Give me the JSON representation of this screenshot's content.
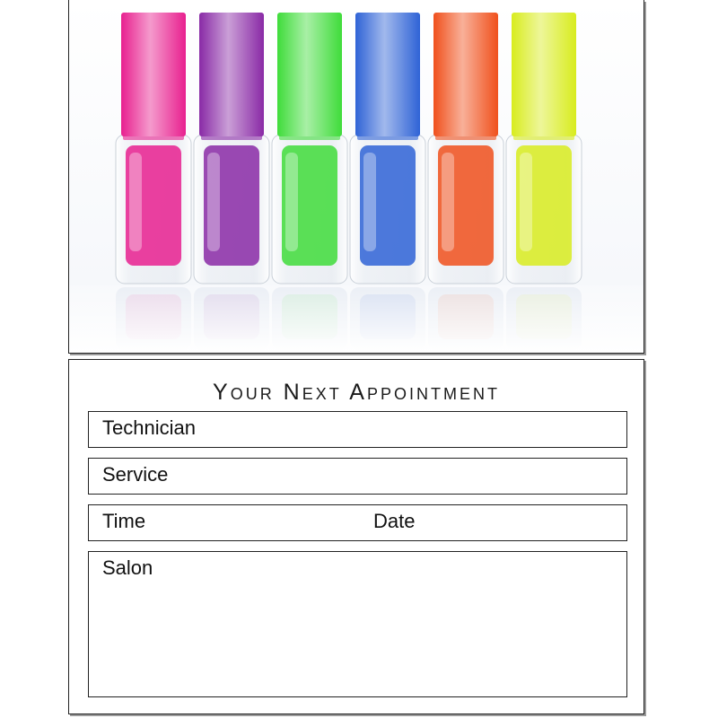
{
  "card": {
    "heading": "Your Next Appointment",
    "fields": {
      "technician": "Technician",
      "service": "Service",
      "time": "Time",
      "date": "Date",
      "salon": "Salon"
    }
  },
  "photo": {
    "subject": "nail-polish-bottles",
    "bottle_colors": [
      "#e8208f",
      "#8a2aa6",
      "#3fdc3a",
      "#2f63d6",
      "#f0501c",
      "#d8ec1e"
    ]
  }
}
